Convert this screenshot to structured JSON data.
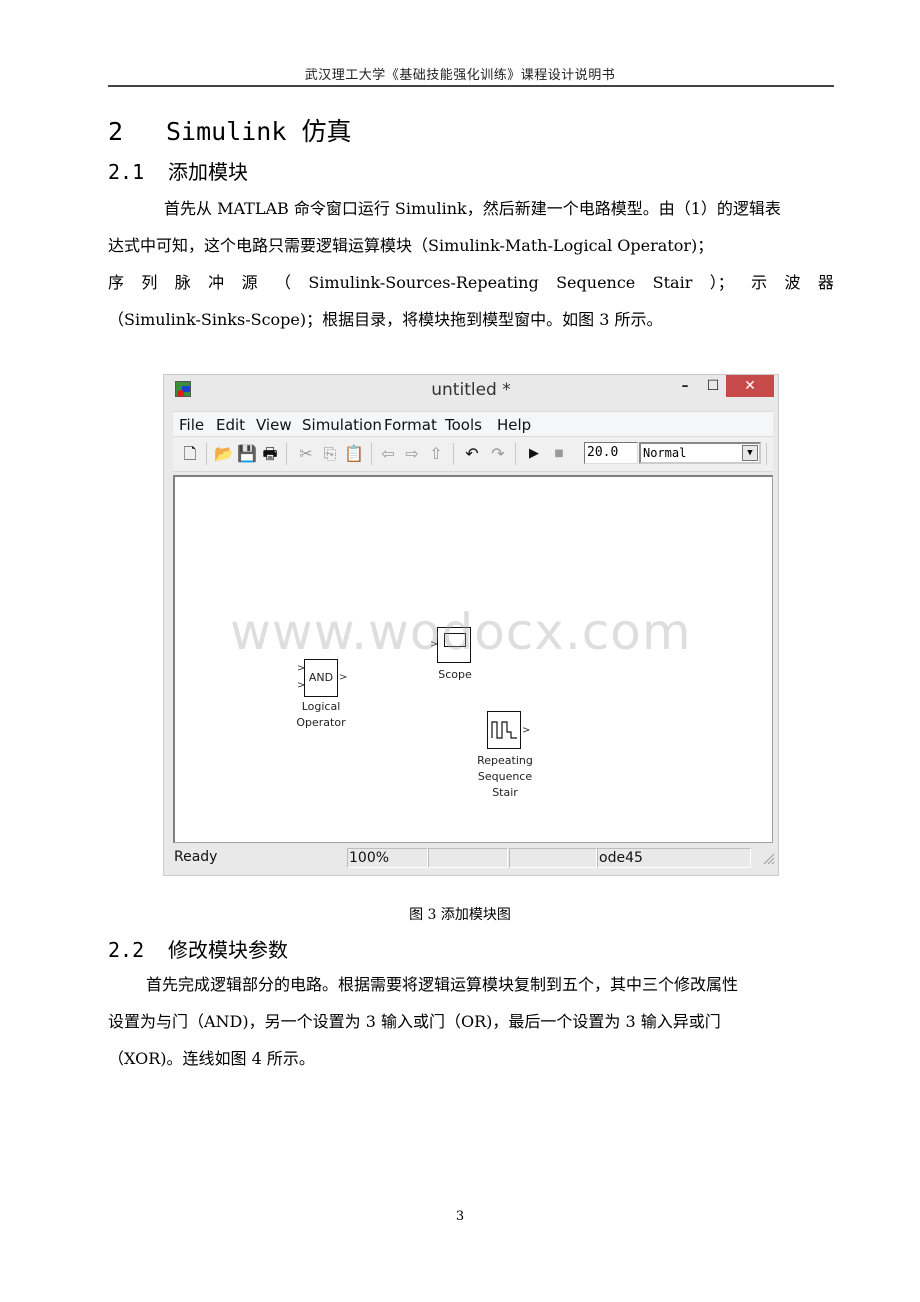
{
  "header": {
    "text": "武汉理工大学《基础技能强化训练》课程设计说明书"
  },
  "section": {
    "number": "2",
    "title_latin": "Simulink",
    "title_zh": "仿真"
  },
  "subsection1": {
    "number": "2.1",
    "title": "添加模块"
  },
  "paragraph1": {
    "lines": [
      "首先从 MATLAB 命令窗口运行 Simulink，然后新建一个电路模型。由（1）的逻辑表",
      "达式中可知，这个电路只需要逻辑运算模块（Simulink-Math-Logical Operator)；",
      [
        "序",
        "列",
        "脉",
        "冲",
        "源",
        "（",
        "Simulink-Sources-Repeating",
        "Sequence",
        "Stair",
        "）；",
        "示",
        "波",
        "器"
      ],
      "（Simulink-Sinks-Scope)；根据目录，将模块拖到模型窗中。如图 3 所示。"
    ]
  },
  "figure": {
    "window": {
      "title": "untitled *",
      "controls": {
        "minimize": "–",
        "maximize": "☐",
        "close": "✕"
      },
      "menu": [
        "File",
        "Edit",
        "View",
        "Simulation",
        "Format",
        "Tools",
        "Help"
      ],
      "toolbar": {
        "icons": [
          {
            "name": "new-icon",
            "glyph": "🗋",
            "enabled": true
          },
          {
            "name": "open-icon",
            "glyph": "📂",
            "enabled": true
          },
          {
            "name": "save-icon",
            "glyph": "💾",
            "enabled": true
          },
          {
            "name": "print-icon",
            "glyph": "🖶",
            "enabled": true
          },
          {
            "name": "cut-icon",
            "glyph": "✂",
            "enabled": false
          },
          {
            "name": "copy-icon",
            "glyph": "⎘",
            "enabled": false
          },
          {
            "name": "paste-icon",
            "glyph": "📋",
            "enabled": false
          },
          {
            "name": "back-icon",
            "glyph": "⇦",
            "enabled": false
          },
          {
            "name": "forward-icon",
            "glyph": "⇨",
            "enabled": false
          },
          {
            "name": "up-icon",
            "glyph": "⇧",
            "enabled": false
          },
          {
            "name": "undo-icon",
            "glyph": "↶",
            "enabled": true
          },
          {
            "name": "redo-icon",
            "glyph": "↷",
            "enabled": false
          },
          {
            "name": "start-icon",
            "glyph": "▶",
            "enabled": true
          },
          {
            "name": "stop-icon",
            "glyph": "■",
            "enabled": false
          }
        ],
        "stop_time": "20.0",
        "sim_mode": "Normal"
      },
      "blocks": {
        "logical_operator": {
          "text": "AND",
          "label_line1": "Logical",
          "label_line2": "Operator"
        },
        "scope": {
          "label": "Scope"
        },
        "repeating_sequence_stair": {
          "label_line1": "Repeating",
          "label_line2": "Sequence",
          "label_line3": "Stair"
        }
      },
      "status": {
        "state": "Ready",
        "zoom": "100%",
        "cell3": "",
        "cell4": "",
        "solver": "ode45"
      }
    },
    "watermark": "www.wodocx.com",
    "caption": "图 3 添加模块图"
  },
  "subsection2": {
    "number": "2.2",
    "title": "修改模块参数"
  },
  "paragraph2": {
    "lines": [
      "首先完成逻辑部分的电路。根据需要将逻辑运算模块复制到五个，其中三个修改属性",
      "设置为与门（AND)，另一个设置为 3 输入或门（OR)，最后一个设置为 3 输入异或门",
      "（XOR)。连线如图 4 所示。"
    ]
  },
  "footer": {
    "page_number": "3"
  }
}
